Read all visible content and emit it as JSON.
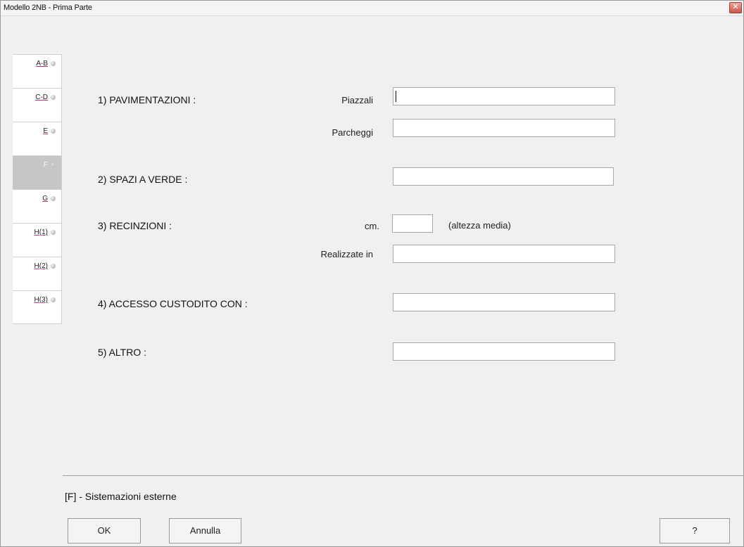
{
  "window": {
    "title": "Modello 2NB - Prima Parte",
    "close_glyph": "✕"
  },
  "tabs": [
    {
      "label": "A-B",
      "active": false
    },
    {
      "label": "C-D",
      "active": false
    },
    {
      "label": "E",
      "active": false
    },
    {
      "label": "F",
      "active": true
    },
    {
      "label": "G",
      "active": false
    },
    {
      "label": "H(1)",
      "active": false
    },
    {
      "label": "H(2)",
      "active": false
    },
    {
      "label": "H(3)",
      "active": false
    }
  ],
  "form": {
    "s1": {
      "title": "1)  PAVIMENTAZIONI :",
      "piazzali_label": "Piazzali",
      "piazzali_value": "",
      "parcheggi_label": "Parcheggi",
      "parcheggi_value": ""
    },
    "s2": {
      "title": "2)  SPAZI A VERDE :",
      "value": ""
    },
    "s3": {
      "title": "3)  RECINZIONI :",
      "cm_label": "cm.",
      "cm_value": "",
      "altezza_label": "(altezza media)",
      "realizzate_label": "Realizzate in",
      "realizzate_value": ""
    },
    "s4": {
      "title": "4)  ACCESSO CUSTODITO CON :",
      "value": ""
    },
    "s5": {
      "title": "5)  ALTRO :",
      "value": ""
    }
  },
  "status": {
    "text": "[F] - Sistemazioni esterne"
  },
  "buttons": {
    "ok": "OK",
    "annulla": "Annulla",
    "help": "?"
  }
}
